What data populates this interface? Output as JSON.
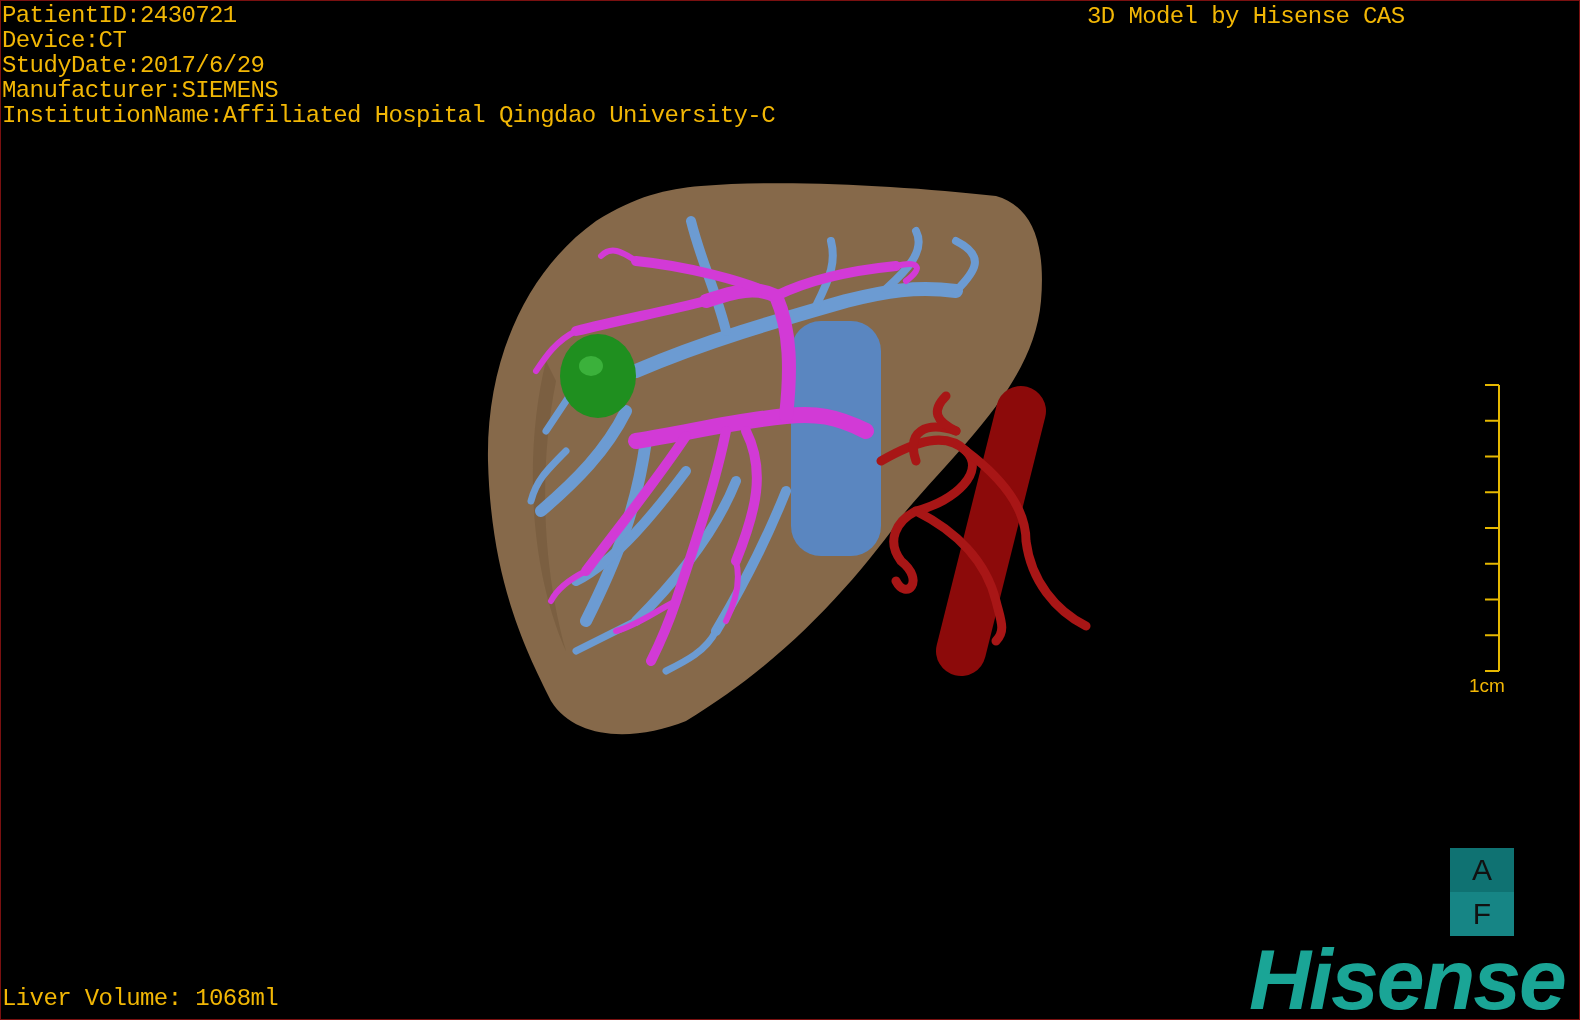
{
  "patient_info": [
    "PatientID:2430721",
    "Device:CT",
    "StudyDate:2017/6/29",
    "Manufacturer:SIEMENS",
    "InstitutionName:Affiliated Hospital Qingdao University-C"
  ],
  "title": "3D Model by Hisense CAS",
  "scale_bar": {
    "label": "1cm"
  },
  "orientation_marker": {
    "top": "A",
    "bottom": "F"
  },
  "logo": "Hisense",
  "liver_volume": "Liver Volume: 1068ml"
}
